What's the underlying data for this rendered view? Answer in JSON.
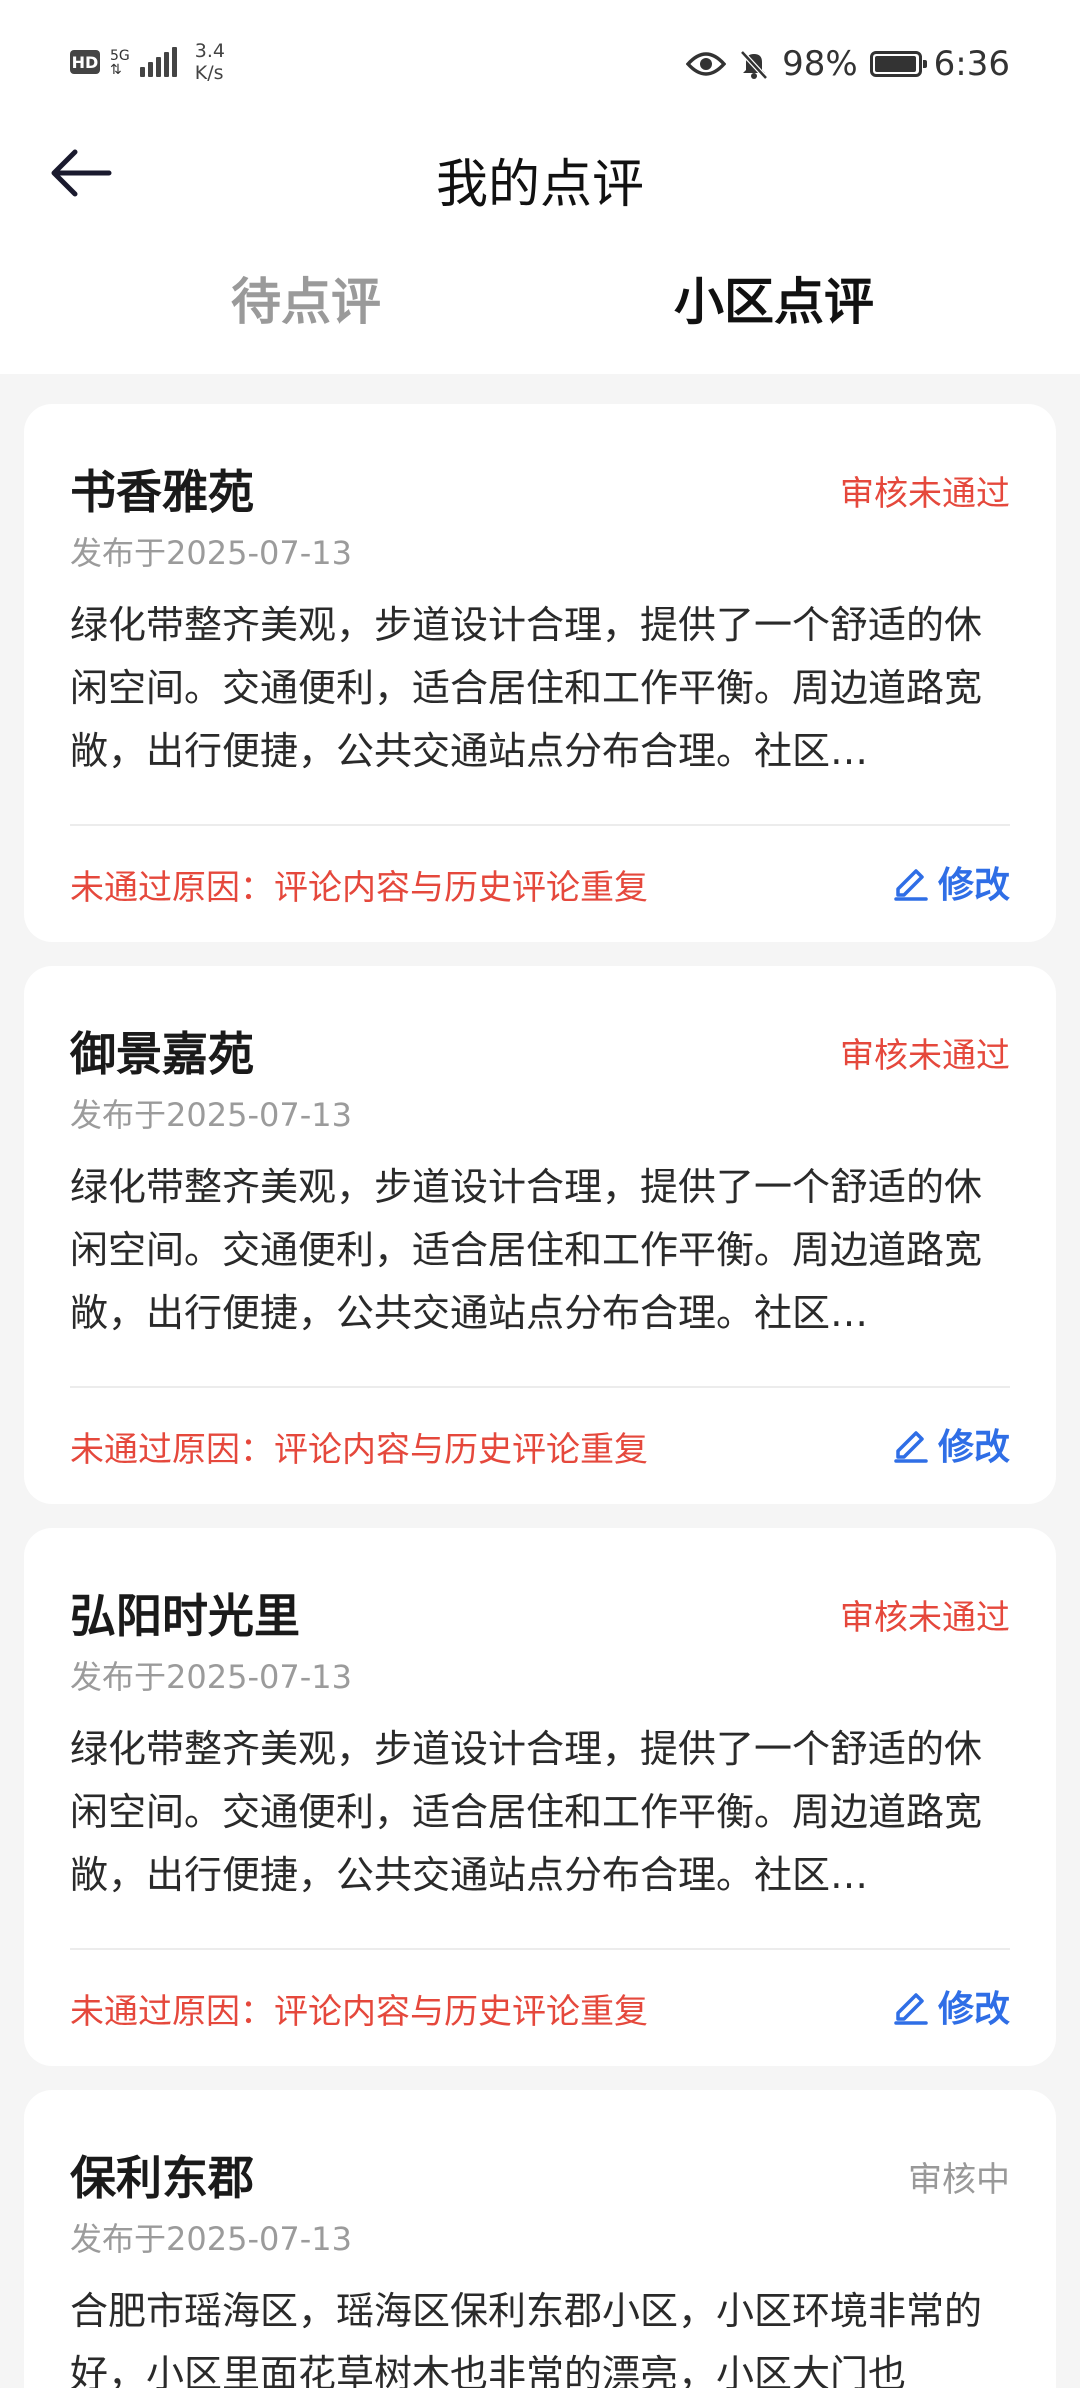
{
  "status_bar": {
    "hd": "HD",
    "network_type": "5G",
    "net_speed_value": "3.4",
    "net_speed_unit": "K/s",
    "battery_percent": "98%",
    "battery_level": 0.98,
    "time": "6:36"
  },
  "header": {
    "title": "我的点评"
  },
  "tabs": [
    {
      "label": "待点评"
    },
    {
      "label": "小区点评"
    }
  ],
  "reviews": [
    {
      "name": "书香雅苑",
      "status": "审核未通过",
      "date": "发布于2025-07-13",
      "text": "绿化带整齐美观，步道设计合理，提供了一个舒适的休闲空间。交通便利，适合居住和工作平衡。周边道路宽敞，出行便捷，公共交通站点分布合理。社区…",
      "reason": "未通过原因：评论内容与历史评论重复",
      "edit_label": "修改"
    },
    {
      "name": "御景嘉苑",
      "status": "审核未通过",
      "date": "发布于2025-07-13",
      "text": "绿化带整齐美观，步道设计合理，提供了一个舒适的休闲空间。交通便利，适合居住和工作平衡。周边道路宽敞，出行便捷，公共交通站点分布合理。社区…",
      "reason": "未通过原因：评论内容与历史评论重复",
      "edit_label": "修改"
    },
    {
      "name": "弘阳时光里",
      "status": "审核未通过",
      "date": "发布于2025-07-13",
      "text": "绿化带整齐美观，步道设计合理，提供了一个舒适的休闲空间。交通便利，适合居住和工作平衡。周边道路宽敞，出行便捷，公共交通站点分布合理。社区…",
      "reason": "未通过原因：评论内容与历史评论重复",
      "edit_label": "修改"
    },
    {
      "name": "保利东郡",
      "status": "审核中",
      "date": "发布于2025-07-13",
      "text": "合肥市瑶海区，瑶海区保利东郡小区，小区环境非常的好，小区里面花草树木也非常的漂亮，小区大门也"
    }
  ],
  "colors": {
    "rejected": "#e5483c",
    "pending": "#999999",
    "accent": "#2f6ee6",
    "background": "#f5f5f5"
  },
  "icons": {
    "back": "arrow-left-icon",
    "edit": "pencil-icon",
    "eye": "eye-icon",
    "mute": "bell-off-icon",
    "battery": "battery-icon"
  }
}
